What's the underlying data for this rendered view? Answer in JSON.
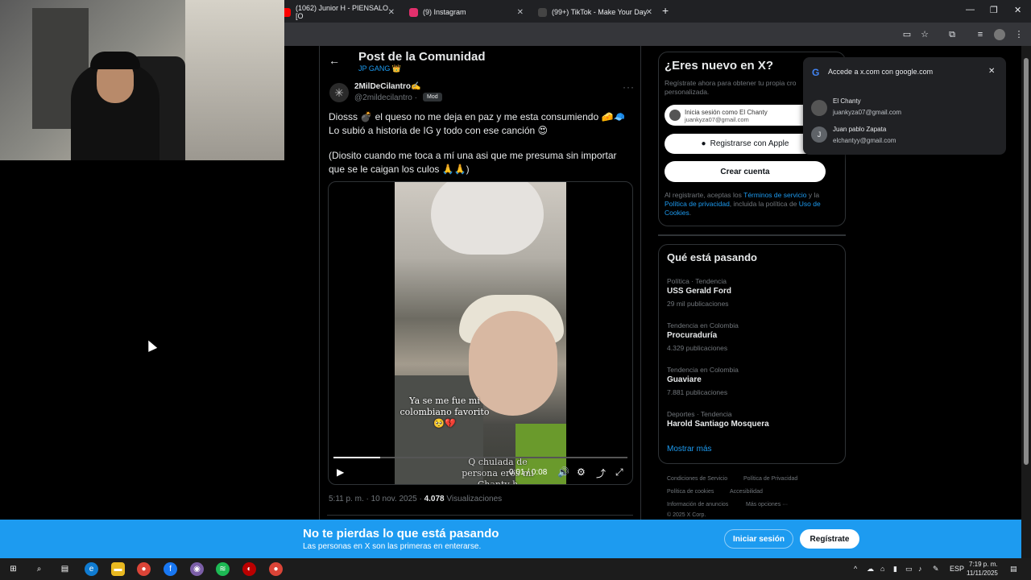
{
  "tabs": [
    {
      "title": "(1062) Junior H - PIENSALO [O",
      "color": "#ff0000"
    },
    {
      "title": "(9) Instagram",
      "color": "#e1306c"
    },
    {
      "title": "(99+) TikTok - Make Your Day",
      "color": "#111111"
    }
  ],
  "post": {
    "header_title": "Post de la Comunidad",
    "community": "JP GANG 👑",
    "author_name": "2MilDeCilantro✍️",
    "author_handle": "@2mildecilantro ·",
    "badge": "Mod",
    "text1": "Diosss 💣 el queso no me deja en paz y me esta consumiendo 🧀🧢 Lo subió a historia de IG y todo con ese canción 😍",
    "text2": "(Diosito cuando me toca a mí una asi que me presuma sin importar que se le caigan los culos 🙏🙏)",
    "video_caption": "Ya se me fue mi colombiano favorito🥺💔",
    "video_caption2": "Q chulada de persona eres mi Chanty h",
    "video_time": "0:01 / 0:08",
    "video_progress": 0.16,
    "timestamp": "5:11 p. m. · 10 nov. 2025 ·",
    "views_count": "4.078",
    "views_label": "Visualizaciones"
  },
  "signup": {
    "title": "¿Eres nuevo en X?",
    "subtitle": "Regístrate ahora para obtener tu propia cro personalizada.",
    "google_line1": "Inicia sesión como El Chanty",
    "google_line2": "juankyza07@gmail.com",
    "apple_label": "Registrarse con Apple",
    "create_label": "Crear cuenta",
    "terms_prefix": "Al registrarte, aceptas los ",
    "terms_link": "Términos de servicio",
    "terms_mid": " y la ",
    "privacy_link": "Política de privacidad",
    "terms_mid2": ", incluida la política de ",
    "cookies_link": "Uso de Cookies",
    "terms_end": "."
  },
  "trends": {
    "title": "Qué está pasando",
    "items": [
      {
        "meta": "Política · Tendencia",
        "name": "USS Gerald Ford",
        "count": "29 mil publicaciones"
      },
      {
        "meta": "Tendencia en Colombia",
        "name": "Procuraduría",
        "count": "4.329 publicaciones"
      },
      {
        "meta": "Tendencia en Colombia",
        "name": "Guaviare",
        "count": "7.881 publicaciones"
      },
      {
        "meta": "Deportes · Tendencia",
        "name": "Harold Santiago Mosquera",
        "count": ""
      }
    ],
    "show_more": "Mostrar más"
  },
  "footer": {
    "terms": "Condiciones de Servicio",
    "privacy": "Política de Privacidad",
    "cookies": "Política de cookies",
    "accessibility": "Accesibilidad",
    "ads": "Información de anuncios",
    "more": "Más opciones ···",
    "copyright": "© 2025 X Corp."
  },
  "google_popup": {
    "title": "Accede a x.com con google.com",
    "accounts": [
      {
        "name": "El Chanty",
        "email": "juankyza07@gmail.com",
        "initial": ""
      },
      {
        "name": "Juan pablo Zapata",
        "email": "elchantyy@gmail.com",
        "initial": "J"
      }
    ]
  },
  "banner": {
    "title": "No te pierdas lo que está pasando",
    "subtitle": "Las personas en X son las primeras en enterarse.",
    "login": "Iniciar sesión",
    "register": "Regístrate"
  },
  "taskbar": {
    "lang": "ESP",
    "time": "7:19 p. m.",
    "date": "11/11/2025"
  },
  "colors": {
    "accent": "#1d9bf0",
    "background": "#000000"
  }
}
